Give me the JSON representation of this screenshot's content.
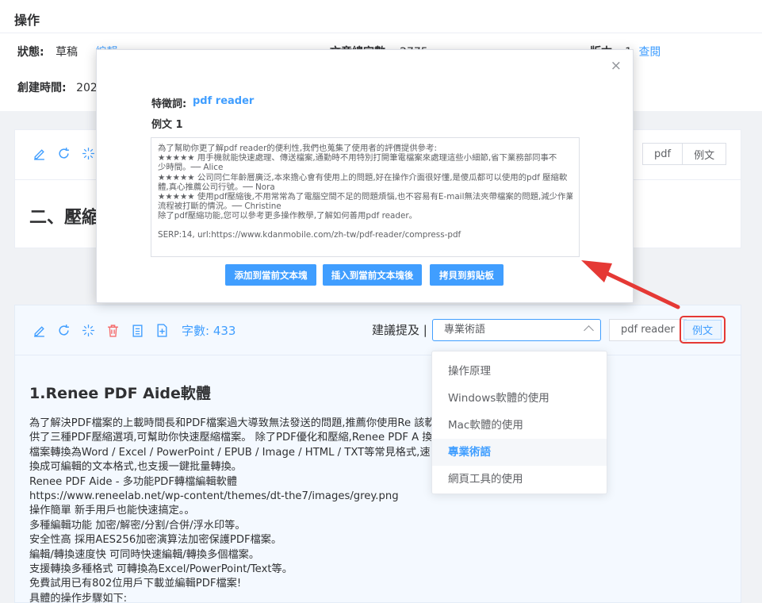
{
  "header": {
    "title": "操作",
    "status_label": "狀態:",
    "status_value": "草稿",
    "status_link": "編輯",
    "wordcount_label": "文章總字數:",
    "wordcount_value": "2775",
    "version_label": "版本:",
    "version_value": "1",
    "version_link": "查閱",
    "created_label": "創建時間:",
    "created_value": "202"
  },
  "card1": {
    "heading": "二、壓縮",
    "btn_pdf": "pdf",
    "btn_example": "例文"
  },
  "card2": {
    "char_count": "字數: 433",
    "suggest_label": "建議提及 |",
    "select_value": "專業術語",
    "keyword_btn": "pdf reader",
    "example_btn": "例文",
    "body_title": "1.Renee PDF Aide軟體",
    "lines": [
      "為了解決PDF檔案的上載時間長和PDF檔案過大導致無法發送的問題,推薦你使用Re                                          該軟體中的“優化”功能提",
      "供了三種PDF壓縮選項,可幫助你快速壓縮檔案。 除了PDF優化和壓縮,Renee PDF A                                          換功能,可將PDF格式的",
      "檔案轉換為Word / Excel / PowerPoint / EPUB / Image / HTML / TXT等常見格式,速                                          掃描檔和圖片中的文字轉",
      "換成可編輯的文本格式,也支援一鍵批量轉換。",
      "Renee PDF Aide - 多功能PDF轉檔編輯軟體",
      "https://www.reneelab.net/wp-content/themes/dt-the7/images/grey.png",
      "操作簡單 新手用戶也能快速搞定。。",
      "多種編輯功能 加密/解密/分割/合併/浮水印等。",
      "安全性高 採用AES256加密演算法加密保護PDF檔案。",
      "編輯/轉換速度快 可同時快速編輯/轉換多個檔案。",
      "支援轉換多種格式 可轉換為Excel/PowerPoint/Text等。",
      "免費試用已有802位用戶下載並編輯PDF檔案!",
      "具體的操作步驟如下:"
    ]
  },
  "dropdown": {
    "items": [
      {
        "label": "操作原理"
      },
      {
        "label": "Windows軟體的使用"
      },
      {
        "label": "Mac軟體的使用"
      },
      {
        "label": "專業術語"
      },
      {
        "label": "網頁工具的使用"
      }
    ]
  },
  "modal": {
    "close": "×",
    "keyword_label": "特徵詞:",
    "keyword_value": "pdf reader",
    "example_label": "例文 1",
    "example_lines": [
      "為了幫助你更了解pdf reader的便利性,我們也蒐集了使用者的評價提供參考:",
      "★★★★★ 用手機就能快速處理、傳送檔案,通勤時不用特別打開筆電檔案來處理這些小細節,省下業務部同事不",
      "少時間。── Alice",
      "★★★★★ 公司同仁年齡層廣泛,本來擔心會有使用上的問題,好在操作介面很好懂,是傻瓜都可以使用的pdf 壓縮軟",
      "體,真心推薦公司行號。── Nora",
      "★★★★★ 使用pdf壓縮後,不用常常為了電腦空間不足的問題煩惱,也不容易有E-mail無法夾帶檔案的問題,減少作業",
      "流程被打斷的情況。── Christine",
      "除了pdf壓縮功能,您可以參考更多操作教學,了解如何善用pdf reader。"
    ],
    "serp": "SERP:14, url:https://www.kdanmobile.com/zh-tw/pdf-reader/compress-pdf",
    "btn_add": "添加到當前文本塊",
    "btn_insert": "插入到當前文本塊後",
    "btn_copy": "拷貝到剪貼板"
  },
  "colors": {
    "accent": "#409eff",
    "danger": "#f56c6c",
    "annotation_red": "#e53935"
  }
}
